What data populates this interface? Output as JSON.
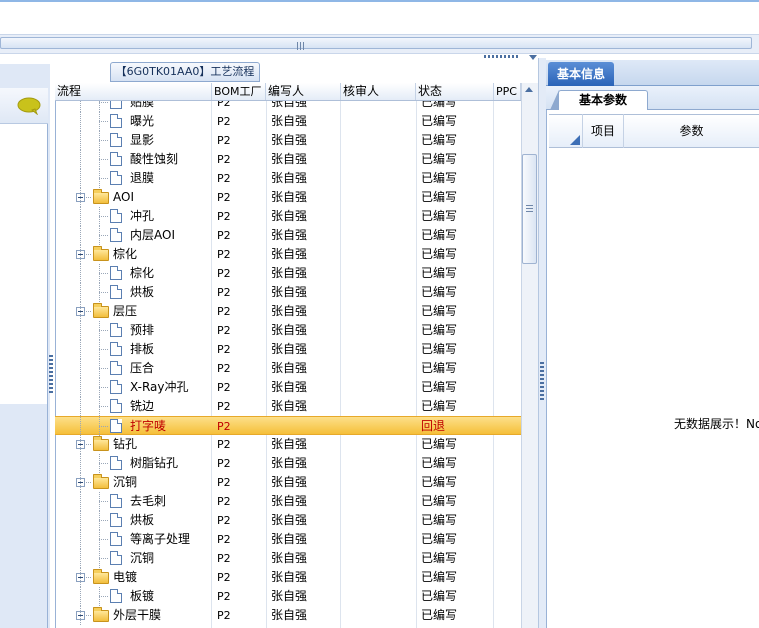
{
  "process_tab": {
    "title": "【6G0TK01AA0】工艺流程"
  },
  "grid": {
    "columns": [
      "流程",
      "BOM工厂",
      "编写人",
      "核审人",
      "状态",
      "PPC"
    ],
    "rows": [
      {
        "name": "贴膜",
        "type": "file",
        "level": 2,
        "bom": "P2",
        "writer": "张自强",
        "status": "已编写"
      },
      {
        "name": "曝光",
        "type": "file",
        "level": 2,
        "bom": "P2",
        "writer": "张自强",
        "status": "已编写"
      },
      {
        "name": "显影",
        "type": "file",
        "level": 2,
        "bom": "P2",
        "writer": "张自强",
        "status": "已编写"
      },
      {
        "name": "酸性蚀刻",
        "type": "file",
        "level": 2,
        "bom": "P2",
        "writer": "张自强",
        "status": "已编写"
      },
      {
        "name": "退膜",
        "type": "file",
        "level": 2,
        "bom": "P2",
        "writer": "张自强",
        "status": "已编写"
      },
      {
        "name": "AOI",
        "type": "folder",
        "level": 1,
        "bom": "P2",
        "writer": "张自强",
        "status": "已编写"
      },
      {
        "name": "冲孔",
        "type": "file",
        "level": 2,
        "bom": "P2",
        "writer": "张自强",
        "status": "已编写"
      },
      {
        "name": "内层AOI",
        "type": "file",
        "level": 2,
        "bom": "P2",
        "writer": "张自强",
        "status": "已编写"
      },
      {
        "name": "棕化",
        "type": "folder",
        "level": 1,
        "bom": "P2",
        "writer": "张自强",
        "status": "已编写"
      },
      {
        "name": "棕化",
        "type": "file",
        "level": 2,
        "bom": "P2",
        "writer": "张自强",
        "status": "已编写"
      },
      {
        "name": "烘板",
        "type": "file",
        "level": 2,
        "bom": "P2",
        "writer": "张自强",
        "status": "已编写"
      },
      {
        "name": "层压",
        "type": "folder",
        "level": 1,
        "bom": "P2",
        "writer": "张自强",
        "status": "已编写"
      },
      {
        "name": "预排",
        "type": "file",
        "level": 2,
        "bom": "P2",
        "writer": "张自强",
        "status": "已编写"
      },
      {
        "name": "排板",
        "type": "file",
        "level": 2,
        "bom": "P2",
        "writer": "张自强",
        "status": "已编写"
      },
      {
        "name": "压合",
        "type": "file",
        "level": 2,
        "bom": "P2",
        "writer": "张自强",
        "status": "已编写"
      },
      {
        "name": "X-Ray冲孔",
        "type": "file",
        "level": 2,
        "bom": "P2",
        "writer": "张自强",
        "status": "已编写"
      },
      {
        "name": "铣边",
        "type": "file",
        "level": 2,
        "bom": "P2",
        "writer": "张自强",
        "status": "已编写"
      },
      {
        "name": "打字唛",
        "type": "file",
        "level": 2,
        "bom": "P2",
        "writer": "",
        "status": "回退",
        "highlight": true
      },
      {
        "name": "钻孔",
        "type": "folder",
        "level": 1,
        "bom": "P2",
        "writer": "张自强",
        "status": "已编写"
      },
      {
        "name": "树脂钻孔",
        "type": "file",
        "level": 2,
        "bom": "P2",
        "writer": "张自强",
        "status": "已编写"
      },
      {
        "name": "沉铜",
        "type": "folder",
        "level": 1,
        "bom": "P2",
        "writer": "张自强",
        "status": "已编写"
      },
      {
        "name": "去毛刺",
        "type": "file",
        "level": 2,
        "bom": "P2",
        "writer": "张自强",
        "status": "已编写"
      },
      {
        "name": "烘板",
        "type": "file",
        "level": 2,
        "bom": "P2",
        "writer": "张自强",
        "status": "已编写"
      },
      {
        "name": "等离子处理",
        "type": "file",
        "level": 2,
        "bom": "P2",
        "writer": "张自强",
        "status": "已编写"
      },
      {
        "name": "沉铜",
        "type": "file",
        "level": 2,
        "bom": "P2",
        "writer": "张自强",
        "status": "已编写"
      },
      {
        "name": "电镀",
        "type": "folder",
        "level": 1,
        "bom": "P2",
        "writer": "张自强",
        "status": "已编写"
      },
      {
        "name": "板镀",
        "type": "file",
        "level": 2,
        "bom": "P2",
        "writer": "张自强",
        "status": "已编写"
      },
      {
        "name": "外层干膜",
        "type": "folder",
        "level": 1,
        "bom": "P2",
        "writer": "张自强",
        "status": "已编写"
      }
    ]
  },
  "right_panel": {
    "tab": "基本信息",
    "subtab": "基本参数",
    "columns": [
      "项目",
      "参数"
    ],
    "empty_text": "无数据展示！No"
  },
  "colors": {
    "accent": "#2a63b8",
    "highlight_row": "#f5bf3a",
    "rollback_text": "#c00000"
  },
  "icons": {
    "left_panel": "speech-bubble-icon",
    "folder": "folder-icon",
    "file": "document-icon"
  }
}
